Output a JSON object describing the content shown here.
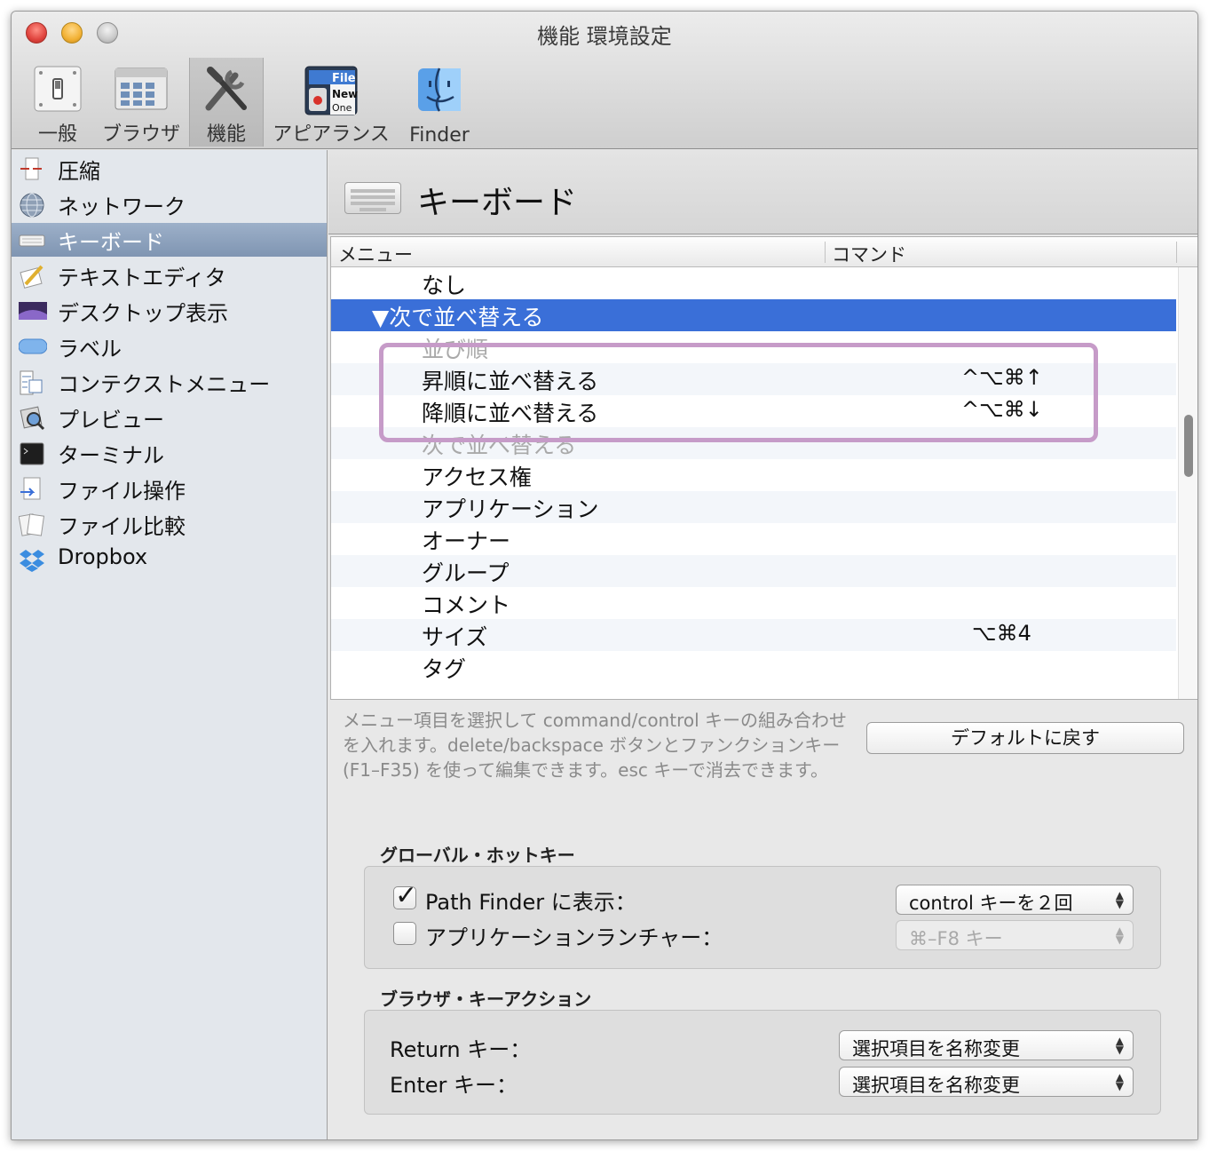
{
  "window": {
    "title": "機能 環境設定"
  },
  "toolbar": {
    "items": [
      {
        "label": "一般",
        "icon": "switch-icon"
      },
      {
        "label": "ブラウザ",
        "icon": "browser-window-icon"
      },
      {
        "label": "機能",
        "icon": "tools-icon",
        "selected": true
      },
      {
        "label": "アピアランス",
        "icon": "appearance-menu-icon",
        "icon_text": [
          "File",
          "New",
          "One"
        ]
      },
      {
        "label": "Finder",
        "icon": "finder-icon"
      }
    ]
  },
  "sidebar": {
    "items": [
      {
        "label": "圧縮",
        "icon": "compress-icon"
      },
      {
        "label": "ネットワーク",
        "icon": "network-globe-icon"
      },
      {
        "label": "キーボード",
        "icon": "keyboard-icon",
        "selected": true
      },
      {
        "label": "テキストエディタ",
        "icon": "text-editor-icon"
      },
      {
        "label": "デスクトップ表示",
        "icon": "desktop-icon"
      },
      {
        "label": "ラベル",
        "icon": "label-icon"
      },
      {
        "label": "コンテクストメニュー",
        "icon": "context-menu-icon"
      },
      {
        "label": "プレビュー",
        "icon": "preview-icon"
      },
      {
        "label": "ターミナル",
        "icon": "terminal-icon"
      },
      {
        "label": "ファイル操作",
        "icon": "file-operation-icon"
      },
      {
        "label": "ファイル比較",
        "icon": "file-compare-icon"
      },
      {
        "label": "Dropbox",
        "icon": "dropbox-icon"
      }
    ]
  },
  "main": {
    "title": "キーボード",
    "table": {
      "headers": {
        "menu": "メニュー",
        "command": "コマンド"
      },
      "rows": [
        {
          "menu": "なし",
          "command": ""
        },
        {
          "menu": "▼次で並べ替える",
          "command": ""
        },
        {
          "menu": "並び順",
          "command": ""
        },
        {
          "menu": "昇順に並べ替える",
          "command": "^⌥⌘↑"
        },
        {
          "menu": "降順に並べ替える",
          "command": "^⌥⌘↓"
        },
        {
          "menu": "次で並べ替える",
          "command": ""
        },
        {
          "menu": "アクセス権",
          "command": ""
        },
        {
          "menu": "アプリケーション",
          "command": ""
        },
        {
          "menu": "オーナー",
          "command": ""
        },
        {
          "menu": "グループ",
          "command": ""
        },
        {
          "menu": "コメント",
          "command": ""
        },
        {
          "menu": "サイズ",
          "command": "⌥⌘4"
        },
        {
          "menu": "タグ",
          "command": ""
        }
      ]
    },
    "help_text": "メニュー項目を選択して command/control キーの組み合わせを入れます。delete/backspace ボタンとファンクションキー (F1–F35) を使って編集できます。esc キーで消去できます。",
    "default_button": "デフォルトに戻す",
    "global_hotkey": {
      "title": "グローバル・ホットキー",
      "path_finder": {
        "label": "Path Finder に表示：",
        "checked": true,
        "popup": "control キーを２回"
      },
      "app_launcher": {
        "label": "アプリケーションランチャー：",
        "checked": false,
        "popup": "⌘–F8 キー"
      }
    },
    "browser_key_action": {
      "title": "ブラウザ・キーアクション",
      "return_key": {
        "label": "Return キー：",
        "popup": "選択項目を名称変更"
      },
      "enter_key": {
        "label": "Enter キー：",
        "popup": "選択項目を名称変更"
      }
    }
  },
  "colors": {
    "selection": "#3a6fd8",
    "highlight_box": "#c69bc8",
    "sidebar_selection": "#8aa0bd"
  }
}
